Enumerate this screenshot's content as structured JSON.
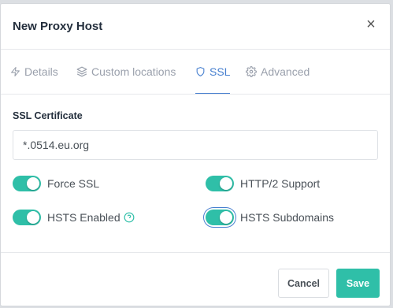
{
  "modal": {
    "title": "New Proxy Host",
    "close_symbol": "×"
  },
  "tabs": [
    {
      "label": "Details",
      "icon": "lightning-icon"
    },
    {
      "label": "Custom locations",
      "icon": "layers-icon"
    },
    {
      "label": "SSL",
      "icon": "shield-icon",
      "active": true
    },
    {
      "label": "Advanced",
      "icon": "gear-icon"
    }
  ],
  "ssl": {
    "certificate_label": "SSL Certificate",
    "certificate_value": "*.0514.eu.org",
    "toggles": [
      {
        "label": "Force SSL",
        "on": true
      },
      {
        "label": "HTTP/2 Support",
        "on": true
      },
      {
        "label": "HSTS Enabled",
        "on": true,
        "help_icon": "question-circle-icon"
      },
      {
        "label": "HSTS Subdomains",
        "on": true
      }
    ]
  },
  "footer": {
    "cancel_label": "Cancel",
    "save_label": "Save"
  },
  "colors": {
    "accent": "#2fbfa8",
    "tab_active": "#467fcf",
    "tab_inactive": "#9aa0ac"
  }
}
